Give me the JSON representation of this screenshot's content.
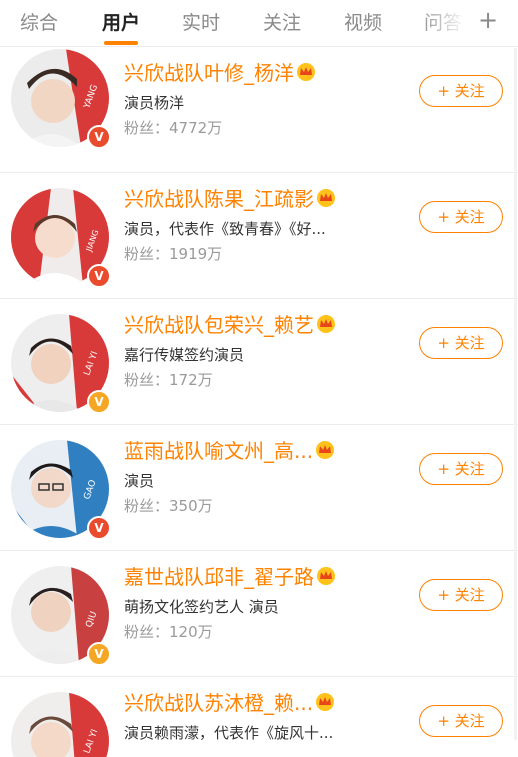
{
  "tabs": [
    {
      "label": "综合"
    },
    {
      "label": "用户"
    },
    {
      "label": "实时"
    },
    {
      "label": "关注"
    },
    {
      "label": "视频"
    },
    {
      "label": "问答"
    }
  ],
  "active_tab": "用户",
  "accent_color": "#ff8200",
  "follow_label": "+ 关注",
  "users": [
    {
      "name": "兴欣战队叶修_杨洋",
      "desc": "演员杨洋",
      "fans": "粉丝：4772万",
      "badge": "red-v",
      "avatar_bg": "#d83a3a",
      "avatar_text": "YANG"
    },
    {
      "name": "兴欣战队陈果_江疏影",
      "desc": "演员，代表作《致青春》《好...",
      "fans": "粉丝：1919万",
      "badge": "red-v",
      "avatar_bg": "#d83a3a",
      "avatar_text": "JIANG"
    },
    {
      "name": "兴欣战队包荣兴_赖艺",
      "desc": "嘉行传媒签约演员",
      "fans": "粉丝：172万",
      "badge": "yellow-v",
      "avatar_bg": "#d83a3a",
      "avatar_text": "LAI YI"
    },
    {
      "name": "蓝雨战队喻文州_高...",
      "desc": "演员",
      "fans": "粉丝：350万",
      "badge": "red-v",
      "avatar_bg": "#2f7fc1",
      "avatar_text": "GAO"
    },
    {
      "name": "嘉世战队邱非_翟子路",
      "desc": "萌扬文化签约艺人 演员",
      "fans": "粉丝：120万",
      "badge": "yellow-v",
      "avatar_bg": "#c84040",
      "avatar_text": "QIU"
    },
    {
      "name": "兴欣战队苏沐橙_赖...",
      "desc": "演员赖雨濛，代表作《旋风十...",
      "fans": "",
      "badge": "red-v",
      "avatar_bg": "#d83a3a",
      "avatar_text": "LAI YI"
    }
  ]
}
